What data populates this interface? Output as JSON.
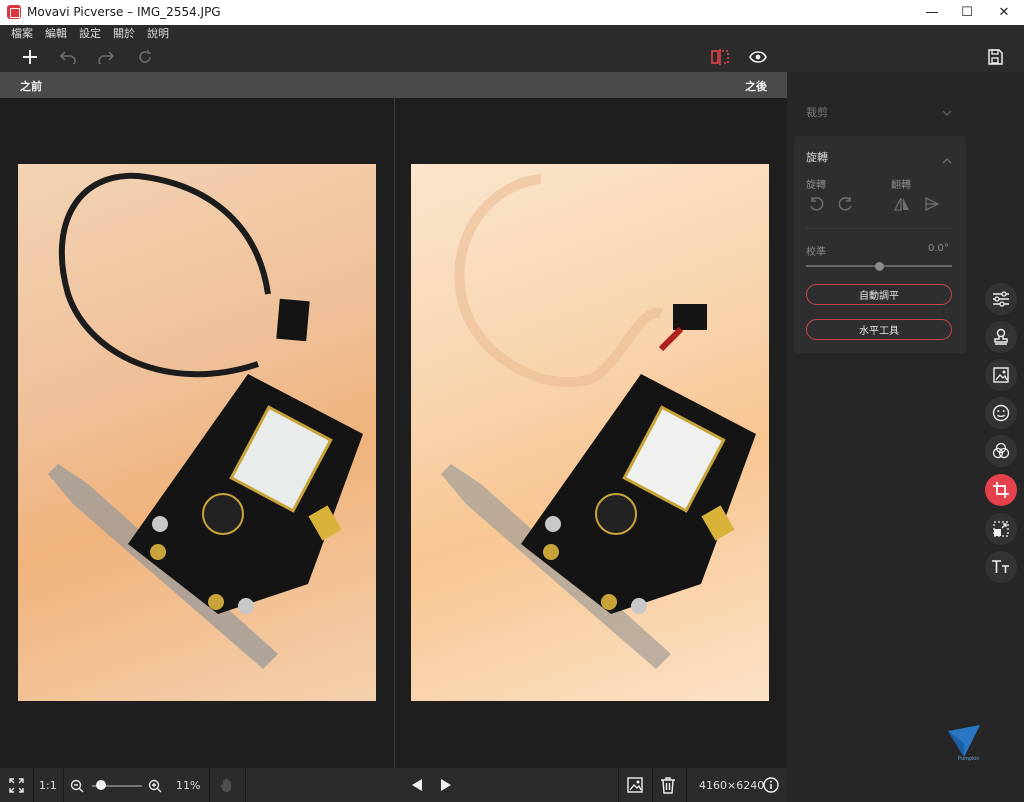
{
  "window": {
    "title": "Movavi Picverse – IMG_2554.JPG",
    "minimize": "—",
    "maximize": "☐",
    "close": "✕"
  },
  "menu": [
    "檔案",
    "編輯",
    "設定",
    "關於",
    "說明"
  ],
  "compare": {
    "before_label": "之前",
    "after_label": "之後"
  },
  "panel": {
    "crop_label": "裁剪",
    "rotate_section": "旋轉",
    "rotate_label": "旋轉",
    "flip_label": "翻轉",
    "straighten_label": "校準",
    "straighten_value": "0.0°",
    "straighten_level": 0.5,
    "auto_level_button": "自動調平",
    "level_tool_button": "水平工具"
  },
  "status": {
    "fit_icon": "fit-screen-icon",
    "one_to_one": "1:1",
    "zoom_value": "11%",
    "zoom_level": 0.1,
    "dimensions": "4160×6240"
  },
  "colors": {
    "accent": "#e5414c",
    "background": "#1e1e1e",
    "panel": "#262626"
  }
}
